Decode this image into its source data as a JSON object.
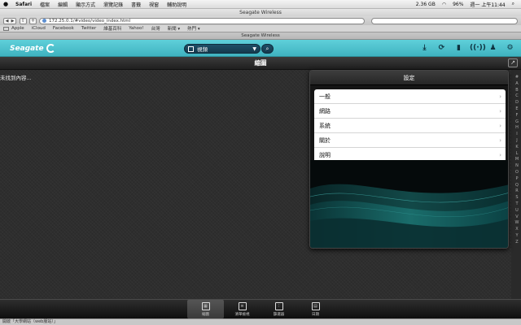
{
  "menubar": {
    "app": "Safari",
    "items": [
      "檔案",
      "編輯",
      "顯示方式",
      "瀏覽記錄",
      "書籤",
      "視窗",
      "輔助說明"
    ],
    "status": {
      "storage": "2.36 GB",
      "battery": "96%",
      "clock": "週一 上午11:44"
    }
  },
  "window": {
    "title": "Seagate Wireless"
  },
  "toolbar": {
    "url": "172.25.0.1/#video/video_index.html"
  },
  "bookmarks": [
    "Apple",
    "iCloud",
    "Facebook",
    "Twitter",
    "維基百科",
    "Yahoo!",
    "台灣",
    "新聞 ▾",
    "熱門 ▾"
  ],
  "tab": {
    "title": "Seagate Wireless"
  },
  "header": {
    "logo": "Seagate",
    "dropdown_label": "視頻"
  },
  "subheader": {
    "title": "縮圖"
  },
  "content": {
    "empty_message": "未找到內容..."
  },
  "alpha_index": [
    "#",
    "A",
    "B",
    "C",
    "D",
    "E",
    "F",
    "G",
    "H",
    "I",
    "J",
    "K",
    "L",
    "M",
    "N",
    "O",
    "P",
    "Q",
    "R",
    "S",
    "T",
    "U",
    "V",
    "W",
    "X",
    "Y",
    "Z"
  ],
  "settings": {
    "title": "設定",
    "items": [
      {
        "label": "一般"
      },
      {
        "label": "網路"
      },
      {
        "label": "系統"
      },
      {
        "label": "關於"
      },
      {
        "label": "說明"
      }
    ]
  },
  "bottom_tabs": [
    {
      "label": "縮圖",
      "icon": "grid-icon",
      "active": true
    },
    {
      "label": "清單檢視",
      "icon": "list-icon",
      "active": false
    },
    {
      "label": "篩選器",
      "icon": "filter-icon",
      "active": false
    },
    {
      "label": "日期",
      "icon": "calendar-icon",
      "active": false
    }
  ],
  "statusbar": {
    "text": "開啟「大學網站（web服站）」"
  },
  "colors": {
    "header_teal": "#4cc4cf",
    "dropdown_bg": "#1b4459"
  }
}
